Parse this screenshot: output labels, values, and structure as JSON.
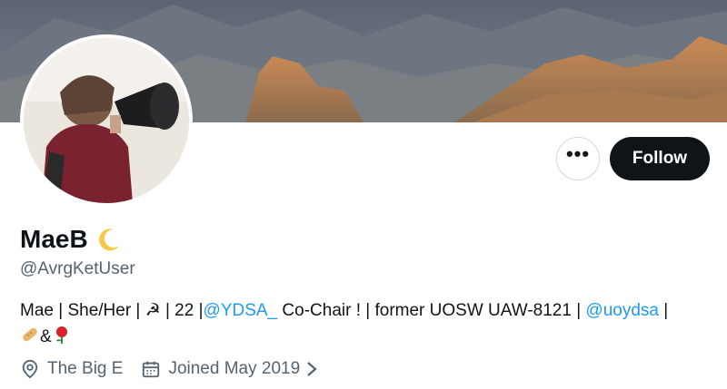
{
  "profile": {
    "display_name": "MaeB",
    "handle": "@AvrgKetUser",
    "bio": {
      "part1": "Mae | She/Her | ☭ | 22 |",
      "mention1": "@YDSA_",
      "part2": " Co-Chair ! | former UOSW UAW-8121 |",
      "mention2": "@uoydsa",
      "part3": " |",
      "part4": "&"
    },
    "location": "The Big E",
    "joined": "Joined May 2019"
  },
  "actions": {
    "more_label": "•••",
    "follow_label": "Follow"
  },
  "icons": {
    "name_emoji": "crescent-moon-icon",
    "location": "location-pin-icon",
    "calendar": "calendar-icon",
    "bio_emoji_1": "bread-icon",
    "bio_emoji_2": "rose-icon"
  },
  "colors": {
    "link": "#1d9bf0",
    "secondary_text": "#536471",
    "follow_bg": "#0f1419"
  }
}
